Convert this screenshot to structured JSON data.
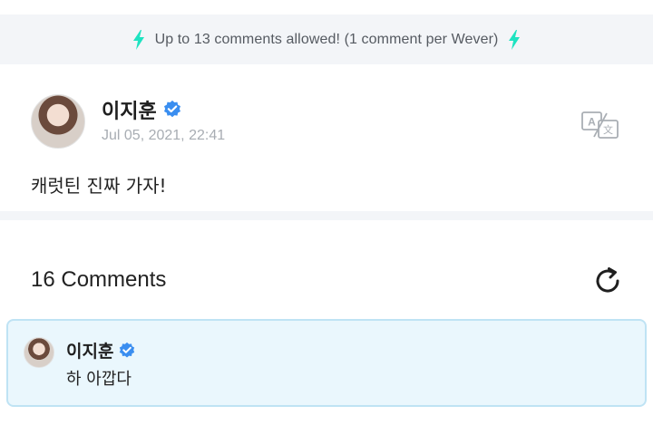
{
  "banner": {
    "text": "Up to 13 comments allowed! (1 comment per Wever)",
    "icon": "lightning-bolt-icon",
    "icon_color": "#1ee3c1"
  },
  "post": {
    "author": "이지훈",
    "verified_icon": "verified-badge-icon",
    "date": "Jul 05, 2021, 22:41",
    "body": "캐럿틴 진짜 가자!",
    "translate_icon": "translate-icon"
  },
  "comments": {
    "header": "16 Comments",
    "refresh_icon": "refresh-icon",
    "items": [
      {
        "author": "이지훈",
        "text": "하 아깝다"
      }
    ]
  },
  "colors": {
    "accent": "#1ee3c1",
    "verified": "#3a8ef0",
    "highlight_bg": "#eaf7fd",
    "highlight_border": "#bfe3f4"
  }
}
